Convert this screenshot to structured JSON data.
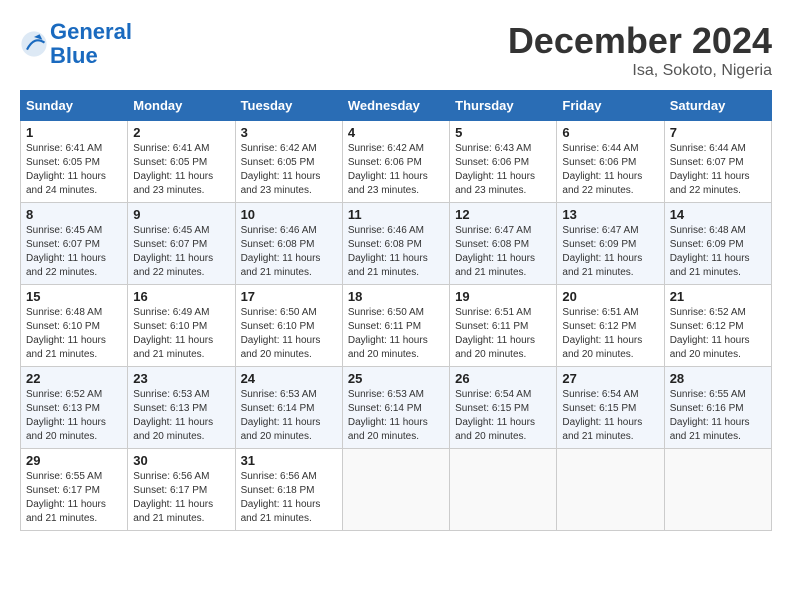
{
  "header": {
    "logo_line1": "General",
    "logo_line2": "Blue",
    "month": "December 2024",
    "location": "Isa, Sokoto, Nigeria"
  },
  "days_of_week": [
    "Sunday",
    "Monday",
    "Tuesday",
    "Wednesday",
    "Thursday",
    "Friday",
    "Saturday"
  ],
  "weeks": [
    [
      {
        "day": "1",
        "sunrise": "6:41 AM",
        "sunset": "6:05 PM",
        "daylight": "11 hours and 24 minutes."
      },
      {
        "day": "2",
        "sunrise": "6:41 AM",
        "sunset": "6:05 PM",
        "daylight": "11 hours and 23 minutes."
      },
      {
        "day": "3",
        "sunrise": "6:42 AM",
        "sunset": "6:05 PM",
        "daylight": "11 hours and 23 minutes."
      },
      {
        "day": "4",
        "sunrise": "6:42 AM",
        "sunset": "6:06 PM",
        "daylight": "11 hours and 23 minutes."
      },
      {
        "day": "5",
        "sunrise": "6:43 AM",
        "sunset": "6:06 PM",
        "daylight": "11 hours and 23 minutes."
      },
      {
        "day": "6",
        "sunrise": "6:44 AM",
        "sunset": "6:06 PM",
        "daylight": "11 hours and 22 minutes."
      },
      {
        "day": "7",
        "sunrise": "6:44 AM",
        "sunset": "6:07 PM",
        "daylight": "11 hours and 22 minutes."
      }
    ],
    [
      {
        "day": "8",
        "sunrise": "6:45 AM",
        "sunset": "6:07 PM",
        "daylight": "11 hours and 22 minutes."
      },
      {
        "day": "9",
        "sunrise": "6:45 AM",
        "sunset": "6:07 PM",
        "daylight": "11 hours and 22 minutes."
      },
      {
        "day": "10",
        "sunrise": "6:46 AM",
        "sunset": "6:08 PM",
        "daylight": "11 hours and 21 minutes."
      },
      {
        "day": "11",
        "sunrise": "6:46 AM",
        "sunset": "6:08 PM",
        "daylight": "11 hours and 21 minutes."
      },
      {
        "day": "12",
        "sunrise": "6:47 AM",
        "sunset": "6:08 PM",
        "daylight": "11 hours and 21 minutes."
      },
      {
        "day": "13",
        "sunrise": "6:47 AM",
        "sunset": "6:09 PM",
        "daylight": "11 hours and 21 minutes."
      },
      {
        "day": "14",
        "sunrise": "6:48 AM",
        "sunset": "6:09 PM",
        "daylight": "11 hours and 21 minutes."
      }
    ],
    [
      {
        "day": "15",
        "sunrise": "6:48 AM",
        "sunset": "6:10 PM",
        "daylight": "11 hours and 21 minutes."
      },
      {
        "day": "16",
        "sunrise": "6:49 AM",
        "sunset": "6:10 PM",
        "daylight": "11 hours and 21 minutes."
      },
      {
        "day": "17",
        "sunrise": "6:50 AM",
        "sunset": "6:10 PM",
        "daylight": "11 hours and 20 minutes."
      },
      {
        "day": "18",
        "sunrise": "6:50 AM",
        "sunset": "6:11 PM",
        "daylight": "11 hours and 20 minutes."
      },
      {
        "day": "19",
        "sunrise": "6:51 AM",
        "sunset": "6:11 PM",
        "daylight": "11 hours and 20 minutes."
      },
      {
        "day": "20",
        "sunrise": "6:51 AM",
        "sunset": "6:12 PM",
        "daylight": "11 hours and 20 minutes."
      },
      {
        "day": "21",
        "sunrise": "6:52 AM",
        "sunset": "6:12 PM",
        "daylight": "11 hours and 20 minutes."
      }
    ],
    [
      {
        "day": "22",
        "sunrise": "6:52 AM",
        "sunset": "6:13 PM",
        "daylight": "11 hours and 20 minutes."
      },
      {
        "day": "23",
        "sunrise": "6:53 AM",
        "sunset": "6:13 PM",
        "daylight": "11 hours and 20 minutes."
      },
      {
        "day": "24",
        "sunrise": "6:53 AM",
        "sunset": "6:14 PM",
        "daylight": "11 hours and 20 minutes."
      },
      {
        "day": "25",
        "sunrise": "6:53 AM",
        "sunset": "6:14 PM",
        "daylight": "11 hours and 20 minutes."
      },
      {
        "day": "26",
        "sunrise": "6:54 AM",
        "sunset": "6:15 PM",
        "daylight": "11 hours and 20 minutes."
      },
      {
        "day": "27",
        "sunrise": "6:54 AM",
        "sunset": "6:15 PM",
        "daylight": "11 hours and 21 minutes."
      },
      {
        "day": "28",
        "sunrise": "6:55 AM",
        "sunset": "6:16 PM",
        "daylight": "11 hours and 21 minutes."
      }
    ],
    [
      {
        "day": "29",
        "sunrise": "6:55 AM",
        "sunset": "6:17 PM",
        "daylight": "11 hours and 21 minutes."
      },
      {
        "day": "30",
        "sunrise": "6:56 AM",
        "sunset": "6:17 PM",
        "daylight": "11 hours and 21 minutes."
      },
      {
        "day": "31",
        "sunrise": "6:56 AM",
        "sunset": "6:18 PM",
        "daylight": "11 hours and 21 minutes."
      },
      null,
      null,
      null,
      null
    ]
  ]
}
